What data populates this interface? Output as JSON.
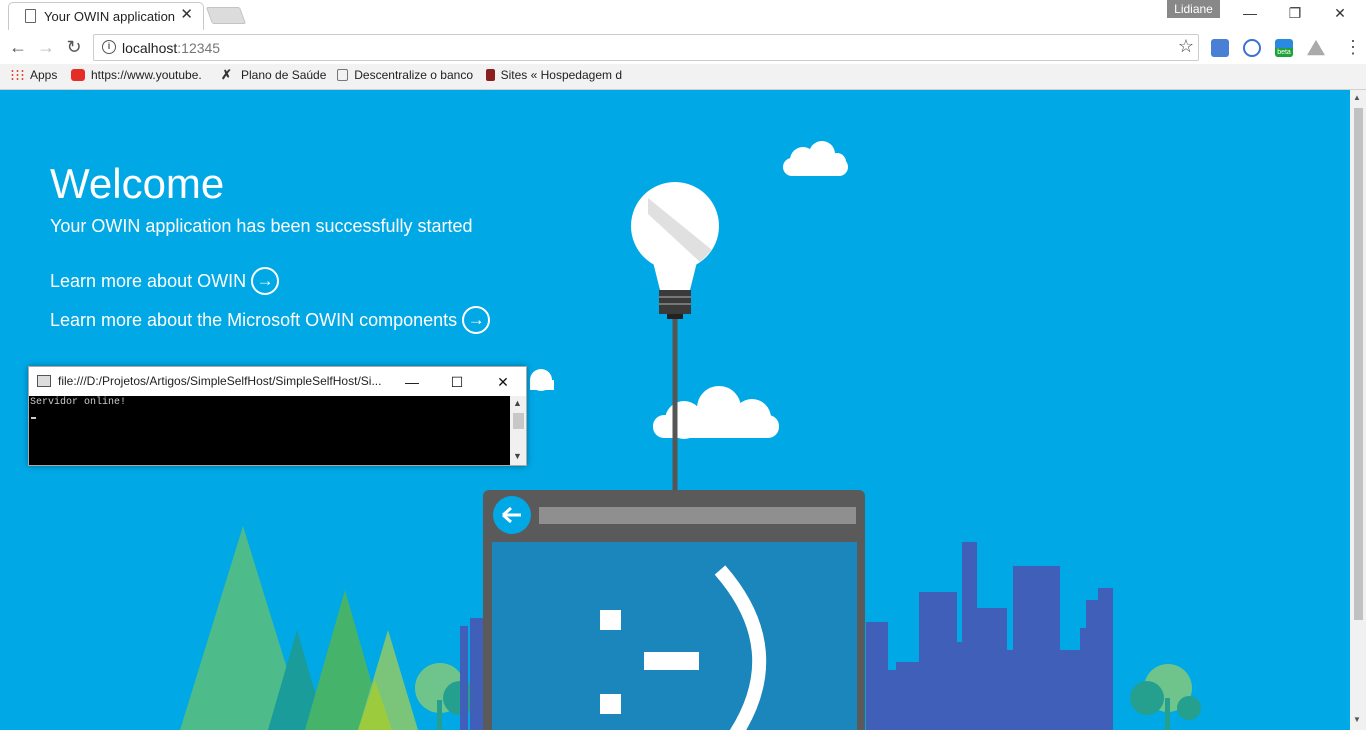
{
  "browser": {
    "tab_title": "Your OWIN application h",
    "tab_close": "✕",
    "profile_name": "Lidiane",
    "window_controls": {
      "minimize": "—",
      "restore": "❐",
      "close": "✕"
    },
    "url_host": "localhost",
    "url_port": ":12345",
    "extensions": [
      "translate-icon",
      "sync-icon",
      "beta-extension-icon",
      "drive-icon"
    ],
    "beta_badge": "beta",
    "bookmarks": [
      {
        "label": "Apps",
        "icon": "apps-grid-icon"
      },
      {
        "label": "https://www.youtube.",
        "icon": "youtube-icon"
      },
      {
        "label": "Plano de Saúde",
        "icon": "cross-icon"
      },
      {
        "label": "Descentralize o banco",
        "icon": "link-icon"
      },
      {
        "label": "Sites « Hospedagem d",
        "icon": "uol-icon"
      }
    ]
  },
  "page": {
    "heading": "Welcome",
    "subtitle": "Your OWIN application has been successfully started",
    "links": [
      {
        "label": "Learn more about OWIN"
      },
      {
        "label": "Learn more about the Microsoft OWIN components"
      }
    ],
    "colors": {
      "background": "#00a8e6",
      "city": "#3f5fb8",
      "monitor_frame": "#5a5a5a",
      "monitor_screen": "#1a86bb",
      "tree_green": "#4dbb8a"
    }
  },
  "console": {
    "title": "file:///D:/Projetos/Artigos/SimpleSelfHost/SimpleSelfHost/Si...",
    "output": "Servidor online!",
    "buttons": {
      "minimize": "—",
      "maximize": "☐",
      "close": "✕"
    }
  }
}
